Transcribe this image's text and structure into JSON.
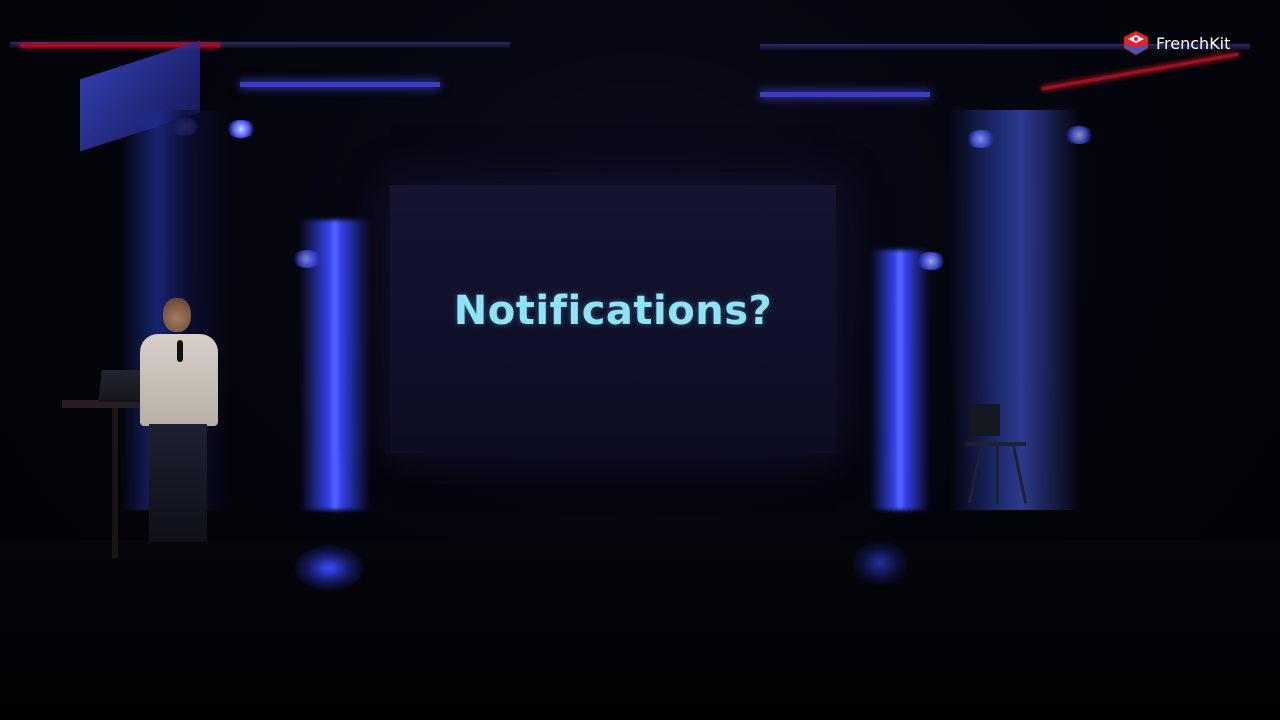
{
  "brand": {
    "name": "FrenchKit",
    "icon": "frenchkit-logo-icon",
    "accent": "#e2232d"
  },
  "slide": {
    "title": "Notifications?",
    "title_color": "#8fe3f6",
    "background": "#12122c"
  },
  "scene": {
    "stage_light_color": "#3848ff"
  }
}
